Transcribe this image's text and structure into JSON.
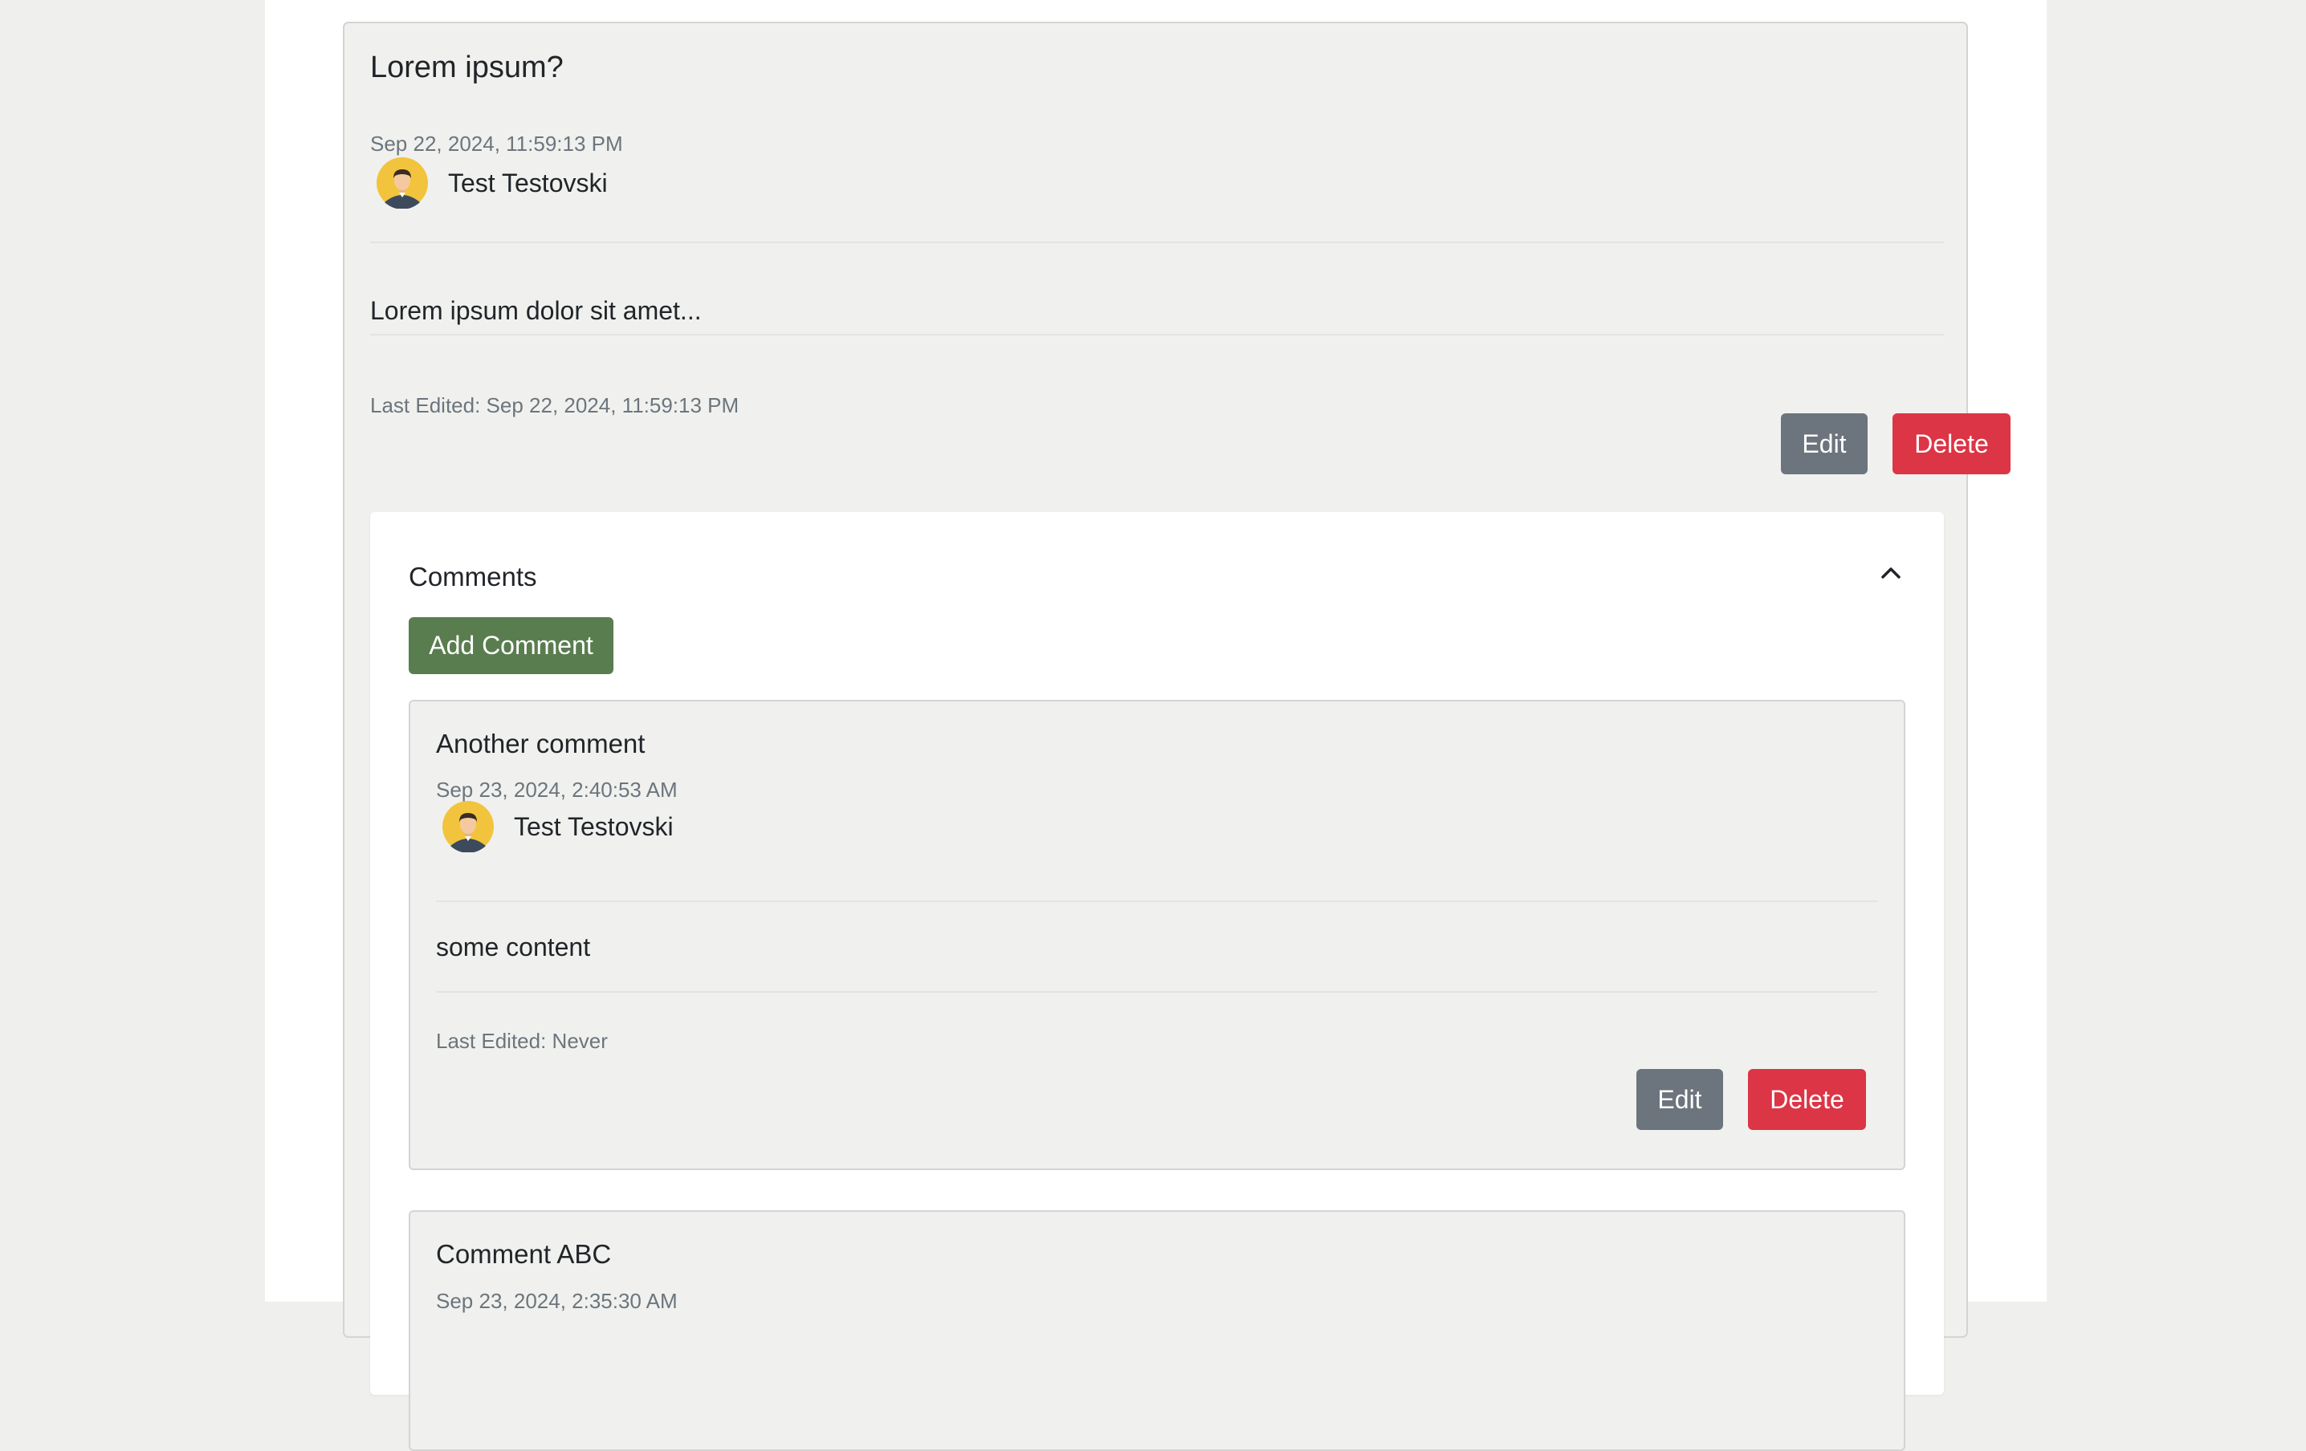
{
  "post": {
    "title": "Lorem ipsum?",
    "date": "Sep 22, 2024, 11:59:13 PM",
    "author": "Test Testovski",
    "content": "Lorem ipsum dolor sit amet...",
    "last_edited": "Last Edited: Sep 22, 2024, 11:59:13 PM",
    "edit_label": "Edit",
    "delete_label": "Delete"
  },
  "comments": {
    "heading": "Comments",
    "add_label": "Add Comment",
    "items": [
      {
        "title": "Another comment",
        "date": "Sep 23, 2024, 2:40:53 AM",
        "author": "Test Testovski",
        "content": "some content",
        "last_edited": "Last Edited: Never",
        "edit_label": "Edit",
        "delete_label": "Delete"
      },
      {
        "title": "Comment ABC",
        "date": "Sep 23, 2024, 2:35:30 AM"
      }
    ]
  },
  "colors": {
    "background": "#eff0ed",
    "card": "#f0f1ee",
    "secondary_button": "#6c757d",
    "danger_button": "#dc3545",
    "success_button": "#5a7d4f",
    "avatar_bg": "#f2c43d"
  },
  "icons": {
    "avatar": "user-avatar-icon",
    "collapse": "chevron-up-icon"
  }
}
